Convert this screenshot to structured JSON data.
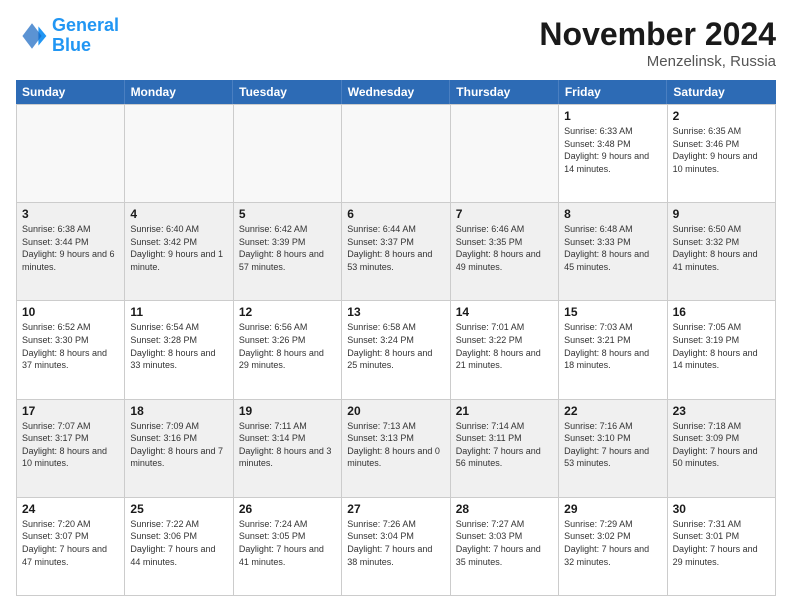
{
  "logo": {
    "line1": "General",
    "line2": "Blue"
  },
  "title": "November 2024",
  "location": "Menzelinsk, Russia",
  "days_of_week": [
    "Sunday",
    "Monday",
    "Tuesday",
    "Wednesday",
    "Thursday",
    "Friday",
    "Saturday"
  ],
  "weeks": [
    [
      {
        "day": "",
        "info": "",
        "empty": true
      },
      {
        "day": "",
        "info": "",
        "empty": true
      },
      {
        "day": "",
        "info": "",
        "empty": true
      },
      {
        "day": "",
        "info": "",
        "empty": true
      },
      {
        "day": "",
        "info": "",
        "empty": true
      },
      {
        "day": "1",
        "info": "Sunrise: 6:33 AM\nSunset: 3:48 PM\nDaylight: 9 hours and 14 minutes.",
        "empty": false
      },
      {
        "day": "2",
        "info": "Sunrise: 6:35 AM\nSunset: 3:46 PM\nDaylight: 9 hours and 10 minutes.",
        "empty": false
      }
    ],
    [
      {
        "day": "3",
        "info": "Sunrise: 6:38 AM\nSunset: 3:44 PM\nDaylight: 9 hours and 6 minutes.",
        "empty": false
      },
      {
        "day": "4",
        "info": "Sunrise: 6:40 AM\nSunset: 3:42 PM\nDaylight: 9 hours and 1 minute.",
        "empty": false
      },
      {
        "day": "5",
        "info": "Sunrise: 6:42 AM\nSunset: 3:39 PM\nDaylight: 8 hours and 57 minutes.",
        "empty": false
      },
      {
        "day": "6",
        "info": "Sunrise: 6:44 AM\nSunset: 3:37 PM\nDaylight: 8 hours and 53 minutes.",
        "empty": false
      },
      {
        "day": "7",
        "info": "Sunrise: 6:46 AM\nSunset: 3:35 PM\nDaylight: 8 hours and 49 minutes.",
        "empty": false
      },
      {
        "day": "8",
        "info": "Sunrise: 6:48 AM\nSunset: 3:33 PM\nDaylight: 8 hours and 45 minutes.",
        "empty": false
      },
      {
        "day": "9",
        "info": "Sunrise: 6:50 AM\nSunset: 3:32 PM\nDaylight: 8 hours and 41 minutes.",
        "empty": false
      }
    ],
    [
      {
        "day": "10",
        "info": "Sunrise: 6:52 AM\nSunset: 3:30 PM\nDaylight: 8 hours and 37 minutes.",
        "empty": false
      },
      {
        "day": "11",
        "info": "Sunrise: 6:54 AM\nSunset: 3:28 PM\nDaylight: 8 hours and 33 minutes.",
        "empty": false
      },
      {
        "day": "12",
        "info": "Sunrise: 6:56 AM\nSunset: 3:26 PM\nDaylight: 8 hours and 29 minutes.",
        "empty": false
      },
      {
        "day": "13",
        "info": "Sunrise: 6:58 AM\nSunset: 3:24 PM\nDaylight: 8 hours and 25 minutes.",
        "empty": false
      },
      {
        "day": "14",
        "info": "Sunrise: 7:01 AM\nSunset: 3:22 PM\nDaylight: 8 hours and 21 minutes.",
        "empty": false
      },
      {
        "day": "15",
        "info": "Sunrise: 7:03 AM\nSunset: 3:21 PM\nDaylight: 8 hours and 18 minutes.",
        "empty": false
      },
      {
        "day": "16",
        "info": "Sunrise: 7:05 AM\nSunset: 3:19 PM\nDaylight: 8 hours and 14 minutes.",
        "empty": false
      }
    ],
    [
      {
        "day": "17",
        "info": "Sunrise: 7:07 AM\nSunset: 3:17 PM\nDaylight: 8 hours and 10 minutes.",
        "empty": false
      },
      {
        "day": "18",
        "info": "Sunrise: 7:09 AM\nSunset: 3:16 PM\nDaylight: 8 hours and 7 minutes.",
        "empty": false
      },
      {
        "day": "19",
        "info": "Sunrise: 7:11 AM\nSunset: 3:14 PM\nDaylight: 8 hours and 3 minutes.",
        "empty": false
      },
      {
        "day": "20",
        "info": "Sunrise: 7:13 AM\nSunset: 3:13 PM\nDaylight: 8 hours and 0 minutes.",
        "empty": false
      },
      {
        "day": "21",
        "info": "Sunrise: 7:14 AM\nSunset: 3:11 PM\nDaylight: 7 hours and 56 minutes.",
        "empty": false
      },
      {
        "day": "22",
        "info": "Sunrise: 7:16 AM\nSunset: 3:10 PM\nDaylight: 7 hours and 53 minutes.",
        "empty": false
      },
      {
        "day": "23",
        "info": "Sunrise: 7:18 AM\nSunset: 3:09 PM\nDaylight: 7 hours and 50 minutes.",
        "empty": false
      }
    ],
    [
      {
        "day": "24",
        "info": "Sunrise: 7:20 AM\nSunset: 3:07 PM\nDaylight: 7 hours and 47 minutes.",
        "empty": false
      },
      {
        "day": "25",
        "info": "Sunrise: 7:22 AM\nSunset: 3:06 PM\nDaylight: 7 hours and 44 minutes.",
        "empty": false
      },
      {
        "day": "26",
        "info": "Sunrise: 7:24 AM\nSunset: 3:05 PM\nDaylight: 7 hours and 41 minutes.",
        "empty": false
      },
      {
        "day": "27",
        "info": "Sunrise: 7:26 AM\nSunset: 3:04 PM\nDaylight: 7 hours and 38 minutes.",
        "empty": false
      },
      {
        "day": "28",
        "info": "Sunrise: 7:27 AM\nSunset: 3:03 PM\nDaylight: 7 hours and 35 minutes.",
        "empty": false
      },
      {
        "day": "29",
        "info": "Sunrise: 7:29 AM\nSunset: 3:02 PM\nDaylight: 7 hours and 32 minutes.",
        "empty": false
      },
      {
        "day": "30",
        "info": "Sunrise: 7:31 AM\nSunset: 3:01 PM\nDaylight: 7 hours and 29 minutes.",
        "empty": false
      }
    ]
  ]
}
